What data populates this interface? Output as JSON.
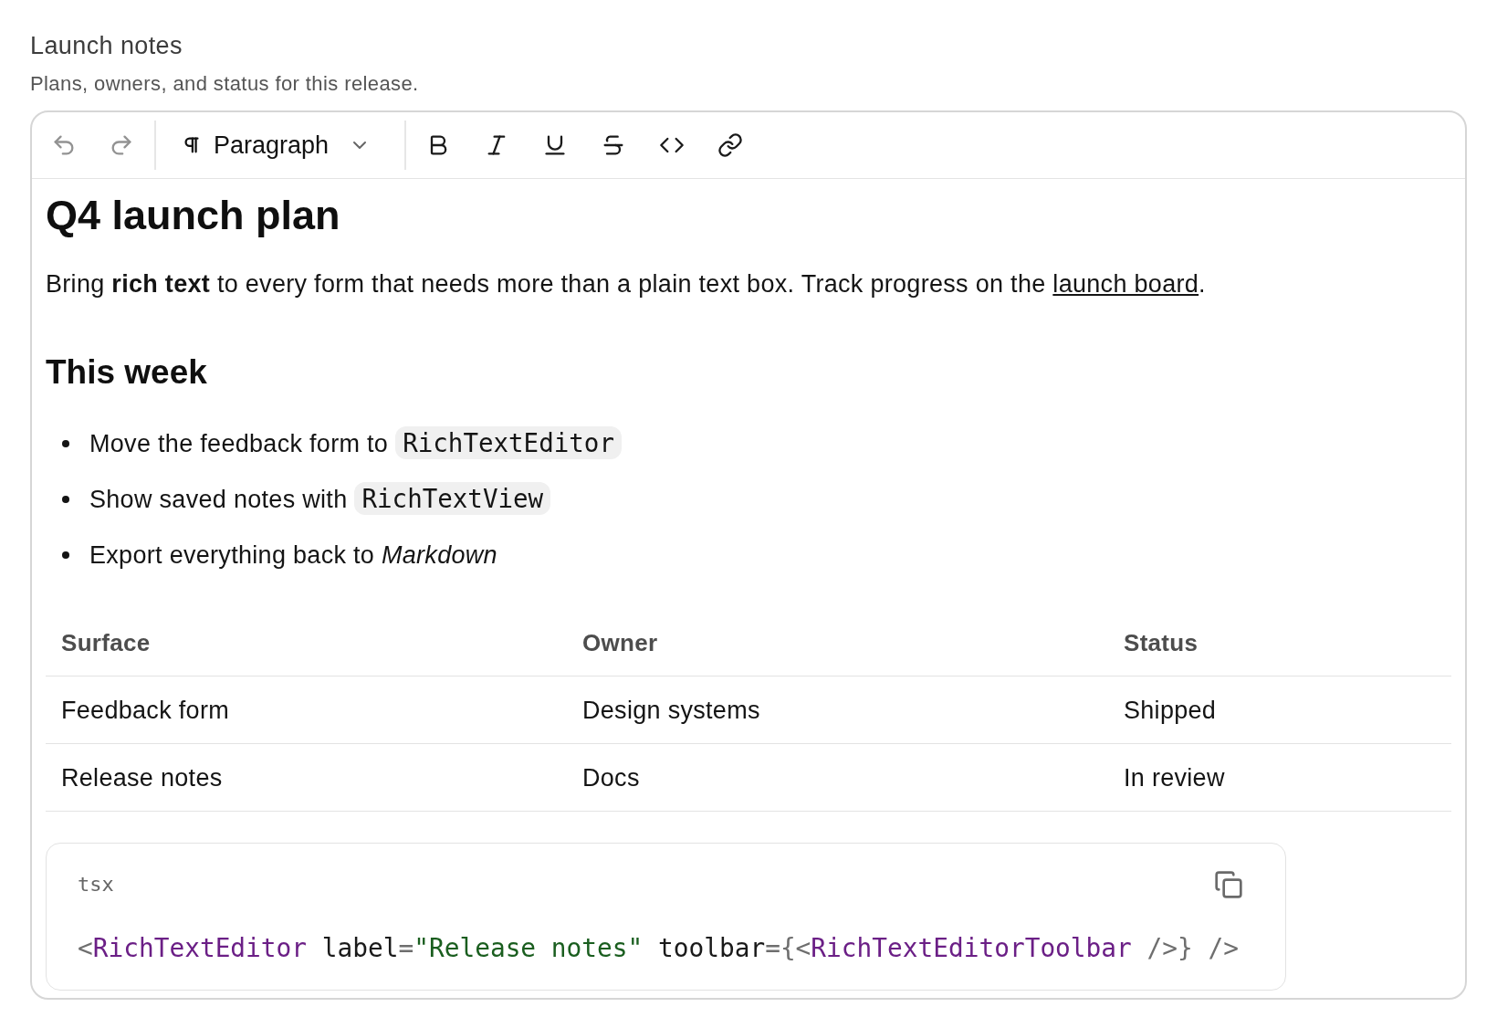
{
  "field": {
    "label": "Launch notes",
    "description": "Plans, owners, and status for this release."
  },
  "toolbar": {
    "history": [
      {
        "kind": "undo",
        "disabled": true
      },
      {
        "kind": "redo",
        "disabled": true
      }
    ],
    "block_type": {
      "value": "Paragraph"
    },
    "marks": [
      {
        "kind": "bold"
      },
      {
        "kind": "italic"
      },
      {
        "kind": "underline"
      },
      {
        "kind": "strikethrough"
      },
      {
        "kind": "code"
      },
      {
        "kind": "link"
      }
    ]
  },
  "document": [
    {
      "kind": "heading1",
      "text": "Q4 launch plan"
    },
    {
      "kind": "paragraph",
      "text": "Bring **rich text** to every form that needs more than a plain text box. Track progress on the",
      "link": "launch board",
      "trailing": "."
    },
    {
      "kind": "heading2",
      "text": "This week"
    },
    {
      "kind": "bullet_list",
      "items": [
        {
          "text": "Move the feedback form to",
          "code": "RichTextEditor"
        },
        {
          "text": "Show saved notes with",
          "code": "RichTextView"
        },
        {
          "text": "Export everything back to *Markdown*"
        }
      ]
    },
    {
      "kind": "table",
      "columns": [
        "Surface",
        "Owner",
        "Status"
      ],
      "rows": [
        [
          "Feedback form",
          "Design systems",
          "Shipped"
        ],
        [
          "Release notes",
          "Docs",
          "In review"
        ]
      ]
    },
    {
      "kind": "code_block",
      "language": "tsx",
      "tokens": [
        {
          "kind": "punct",
          "text": "<"
        },
        {
          "kind": "tag",
          "text": "RichTextEditor"
        },
        {
          "kind": "attr",
          "text": " label"
        },
        {
          "kind": "punct",
          "text": "="
        },
        {
          "kind": "string",
          "text": "\"Release notes\""
        },
        {
          "kind": "attr",
          "text": " toolbar"
        },
        {
          "kind": "punct",
          "text": "={<"
        },
        {
          "kind": "tag",
          "text": "RichTextEditorToolbar"
        },
        {
          "kind": "punct",
          "text": " />} />"
        }
      ]
    }
  ]
}
